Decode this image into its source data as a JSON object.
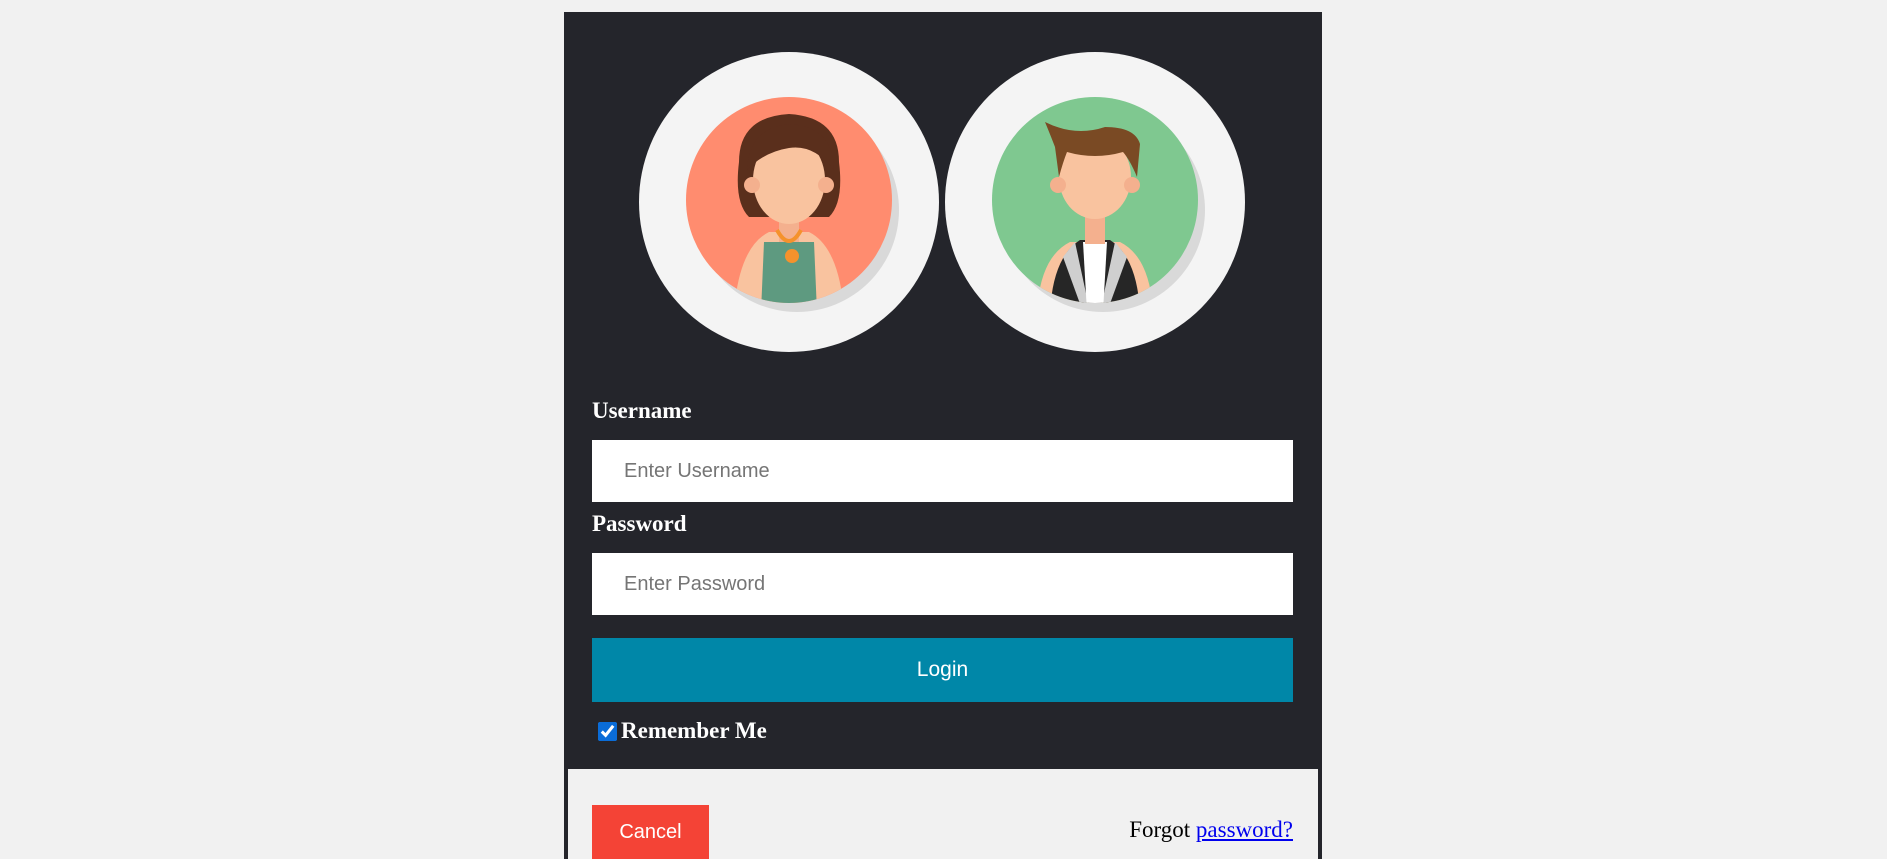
{
  "form": {
    "username_label": "Username",
    "username_placeholder": "Enter Username",
    "username_value": "",
    "password_label": "Password",
    "password_placeholder": "Enter Password",
    "password_value": "",
    "login_label": "Login",
    "remember_label": "Remember Me",
    "remember_checked": true
  },
  "footer": {
    "cancel_label": "Cancel",
    "forgot_prefix": "Forgot",
    "forgot_link": "password?"
  },
  "avatars": [
    {
      "icon": "female-avatar-icon",
      "background": "#ff8c6f"
    },
    {
      "icon": "male-avatar-icon",
      "background": "#7fc890"
    }
  ],
  "colors": {
    "card_background": "#24252b",
    "login_button": "#0087a8",
    "cancel_button": "#f44336",
    "page_background": "#f1f1f1"
  }
}
